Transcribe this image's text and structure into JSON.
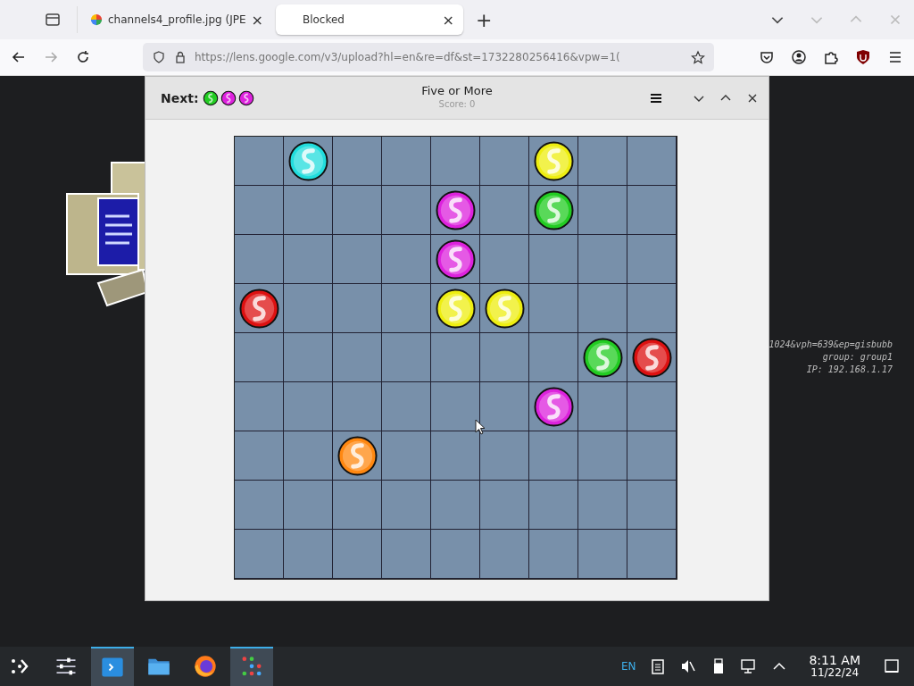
{
  "browser": {
    "tabs": [
      {
        "label": "channels4_profile.jpg (JPE",
        "selected": false,
        "close": "×"
      },
      {
        "label": "Blocked",
        "selected": true,
        "close": "×"
      }
    ],
    "new_tab": "+",
    "url": "https://lens.google.com/v3/upload?hl=en&re=df&st=1732280256416&vpw=1("
  },
  "desktop": {
    "overlay_lines": [
      "1024&vph=639&ep=gisbubb",
      "group: group1",
      "IP: 192.168.1.17"
    ]
  },
  "game": {
    "title": "Five or More",
    "score": "Score: 0",
    "next_label": "Next:",
    "next": [
      {
        "color": "#22cc22"
      },
      {
        "color": "#dd22dd"
      },
      {
        "color": "#dd22dd"
      }
    ],
    "board": [
      [
        {
          "kind": "empty"
        },
        {
          "kind": "ball",
          "color": "#22dddd"
        },
        {
          "kind": "empty"
        },
        {
          "kind": "empty"
        },
        {
          "kind": "empty"
        },
        {
          "kind": "empty"
        },
        {
          "kind": "ball",
          "color": "#eeee11"
        },
        {
          "kind": "empty"
        },
        {
          "kind": "empty"
        }
      ],
      [
        {
          "kind": "empty"
        },
        {
          "kind": "empty"
        },
        {
          "kind": "empty"
        },
        {
          "kind": "empty"
        },
        {
          "kind": "ball",
          "color": "#dd22dd"
        },
        {
          "kind": "empty"
        },
        {
          "kind": "ball",
          "color": "#22cc22"
        },
        {
          "kind": "empty"
        },
        {
          "kind": "empty"
        }
      ],
      [
        {
          "kind": "empty"
        },
        {
          "kind": "empty"
        },
        {
          "kind": "empty"
        },
        {
          "kind": "empty"
        },
        {
          "kind": "ball",
          "color": "#dd22dd"
        },
        {
          "kind": "empty"
        },
        {
          "kind": "empty"
        },
        {
          "kind": "empty"
        },
        {
          "kind": "empty"
        }
      ],
      [
        {
          "kind": "ball",
          "color": "#dd1111"
        },
        {
          "kind": "empty"
        },
        {
          "kind": "empty"
        },
        {
          "kind": "empty"
        },
        {
          "kind": "ball",
          "color": "#eeee11"
        },
        {
          "kind": "ball",
          "color": "#eeee11"
        },
        {
          "kind": "empty"
        },
        {
          "kind": "empty"
        },
        {
          "kind": "empty"
        }
      ],
      [
        {
          "kind": "empty"
        },
        {
          "kind": "empty"
        },
        {
          "kind": "empty"
        },
        {
          "kind": "empty"
        },
        {
          "kind": "empty"
        },
        {
          "kind": "empty"
        },
        {
          "kind": "empty"
        },
        {
          "kind": "ball",
          "color": "#22cc22"
        },
        {
          "kind": "ball",
          "color": "#dd1111"
        }
      ],
      [
        {
          "kind": "empty"
        },
        {
          "kind": "empty"
        },
        {
          "kind": "empty"
        },
        {
          "kind": "empty"
        },
        {
          "kind": "empty"
        },
        {
          "kind": "empty"
        },
        {
          "kind": "ball",
          "color": "#dd22dd"
        },
        {
          "kind": "empty"
        },
        {
          "kind": "empty"
        }
      ],
      [
        {
          "kind": "empty"
        },
        {
          "kind": "empty"
        },
        {
          "kind": "ball",
          "color": "#ff8811"
        },
        {
          "kind": "empty"
        },
        {
          "kind": "empty"
        },
        {
          "kind": "empty"
        },
        {
          "kind": "empty"
        },
        {
          "kind": "empty"
        },
        {
          "kind": "empty"
        }
      ],
      [
        {
          "kind": "empty"
        },
        {
          "kind": "empty"
        },
        {
          "kind": "empty"
        },
        {
          "kind": "empty"
        },
        {
          "kind": "empty"
        },
        {
          "kind": "empty"
        },
        {
          "kind": "empty"
        },
        {
          "kind": "empty"
        },
        {
          "kind": "empty"
        }
      ],
      [
        {
          "kind": "empty"
        },
        {
          "kind": "empty"
        },
        {
          "kind": "empty"
        },
        {
          "kind": "empty"
        },
        {
          "kind": "empty"
        },
        {
          "kind": "empty"
        },
        {
          "kind": "empty"
        },
        {
          "kind": "empty"
        },
        {
          "kind": "empty"
        }
      ]
    ]
  },
  "taskbar": {
    "apps": [
      {
        "selected": false
      },
      {
        "selected": true
      },
      {
        "selected": false
      },
      {
        "selected": false
      },
      {
        "selected": true
      }
    ],
    "language": "EN",
    "time": "8:11 AM",
    "date": "11/22/24"
  }
}
